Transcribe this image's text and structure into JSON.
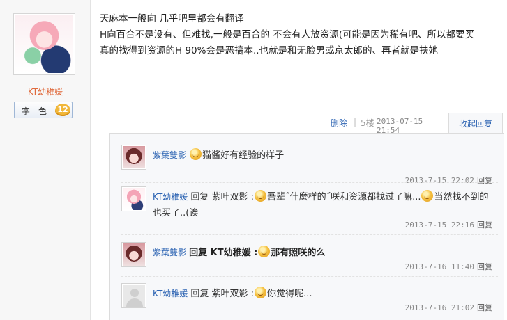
{
  "author": {
    "username": "KT幼稚媛",
    "badge_text": "字一色",
    "badge_level": "12"
  },
  "post": {
    "lines": [
      "天麻本一般向 几乎吧里都会有翻译",
      "H向百合不是没有、但难找,一般是百合的 不会有人放资源(可能是因为稀有吧、所以都要买",
      "真的找得到资源的H 90%会是恶搞本..也就是和无脸男或京太郎的、再者就是扶她"
    ]
  },
  "meta": {
    "delete_label": "删除",
    "separator": "|",
    "floor": "5楼",
    "time": "2013-07-15 21:54",
    "collapse_label": "收起回复"
  },
  "replies": [
    {
      "user": "紫葉雙影",
      "prefix": "",
      "content": "猫酱好有经验的样子",
      "time": "2013-7-15 22:02",
      "reply_label": "回复"
    },
    {
      "user": "KT幼稚媛",
      "prefix": "回复 紫叶双影 :",
      "content": "吾辈˝什麼样的˝咲和资源都找过了嘛...",
      "content2": "当然找不到的也买了..(诶",
      "time": "2013-7-15 22:16",
      "reply_label": "回复"
    },
    {
      "user": "紫葉雙影",
      "prefix": "回复 KT幼稚媛 :",
      "content": "那有照咲的么",
      "time": "2013-7-16 11:40",
      "reply_label": "回复"
    },
    {
      "user": "KT幼稚媛",
      "prefix": "回复 紫叶双影 :",
      "content": "你觉得呢...",
      "time": "2013-7-16 21:02",
      "reply_label": "回复"
    }
  ]
}
